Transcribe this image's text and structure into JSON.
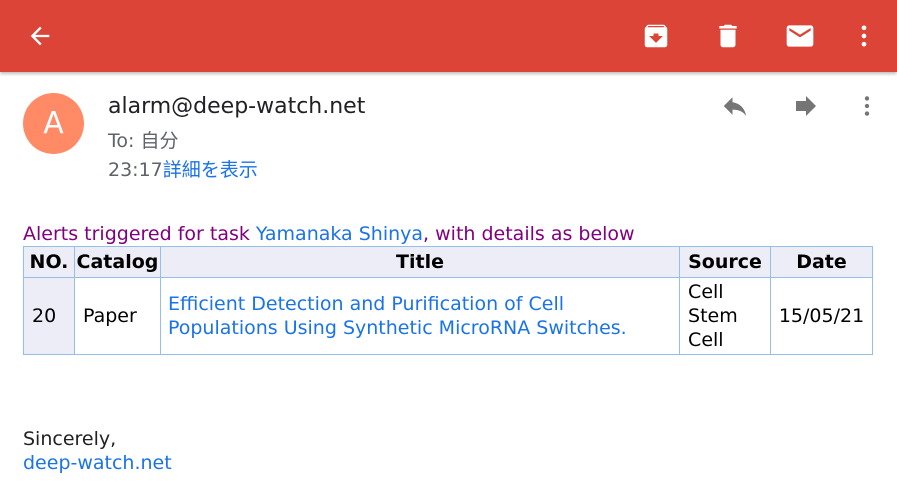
{
  "toolbar": {
    "back_icon": "arrow-back-icon",
    "archive_icon": "archive-icon",
    "delete_icon": "trash-icon",
    "mark_unread_icon": "mail-icon",
    "more_icon": "more-vert-icon",
    "bar_color": "#db4437"
  },
  "message": {
    "avatar_letter": "A",
    "avatar_color": "#ff8a65",
    "sender": "alarm@deep-watch.net",
    "to": "To: 自分",
    "time": "23:17",
    "details_link": "詳細を表示",
    "reply_icon": "reply-icon",
    "forward_icon": "forward-icon",
    "more_icon": "more-vert-icon"
  },
  "body": {
    "intro_prefix": "Alerts triggered for task ",
    "task_name": "Yamanaka Shinya",
    "intro_suffix": ", with details as below",
    "table": {
      "headers": [
        "NO.",
        "Catalog",
        "Title",
        "Source",
        "Date"
      ],
      "rows": [
        {
          "no": "20",
          "catalog": "Paper",
          "title": "Efficient Detection and Purification of Cell Populations Using Synthetic MicroRNA Switches.",
          "source": "Cell Stem Cell",
          "date": "15/05/21"
        }
      ]
    },
    "closing": "Sincerely,",
    "signature_link": "deep-watch.net"
  }
}
